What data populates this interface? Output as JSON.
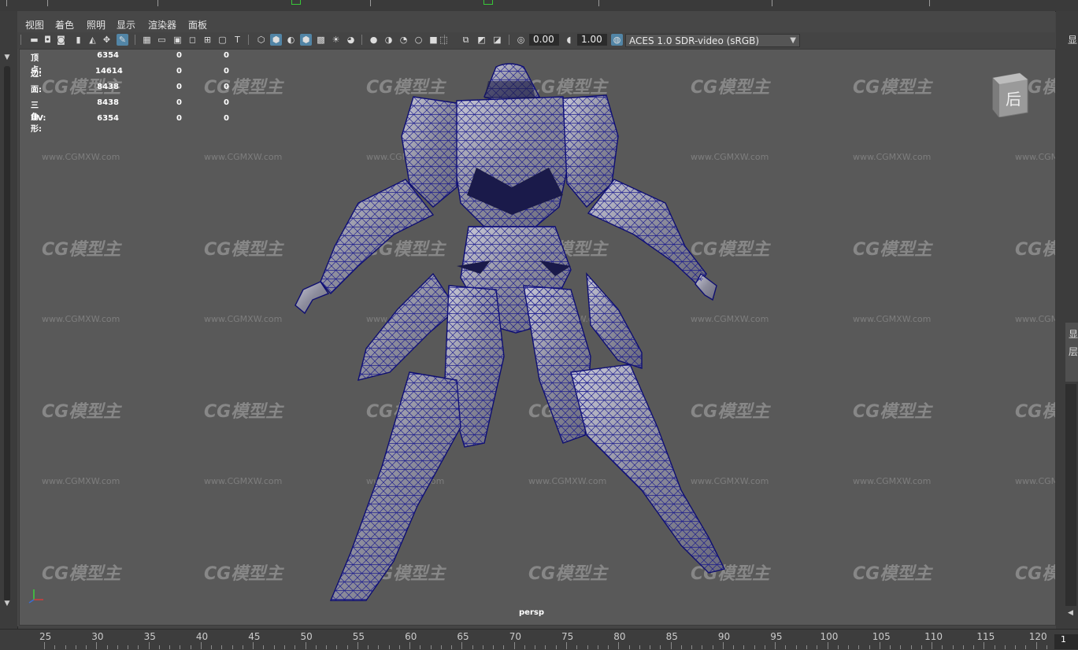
{
  "menu": [
    "视图",
    "着色",
    "照明",
    "显示",
    "渲染器",
    "面板"
  ],
  "toolbar": {
    "exposure": "0.00",
    "gamma": "1.00",
    "color_space": "ACES 1.0 SDR-video (sRGB)"
  },
  "stats": [
    {
      "label": "顶点:",
      "v1": "6354",
      "v2": "0",
      "v3": "0"
    },
    {
      "label": "边:",
      "v1": "14614",
      "v2": "0",
      "v3": "0"
    },
    {
      "label": "面:",
      "v1": "8438",
      "v2": "0",
      "v3": "0"
    },
    {
      "label": "三角形:",
      "v1": "8438",
      "v2": "0",
      "v3": "0"
    },
    {
      "label": "UV:",
      "v1": "6354",
      "v2": "0",
      "v3": "0"
    }
  ],
  "camera_label": "persp",
  "view_cube_label": "后",
  "right_dock": {
    "char1": "显",
    "char2": "层"
  },
  "watermark": {
    "logo": "CG模型主",
    "url": "www.CGMXW.com"
  },
  "timeline": {
    "numbers": [
      "25",
      "30",
      "35",
      "40",
      "45",
      "50",
      "55",
      "60",
      "65",
      "70",
      "75",
      "80",
      "85",
      "90",
      "95",
      "100",
      "105",
      "110",
      "115",
      "120"
    ],
    "current_frame": "1"
  },
  "colors": {
    "viewport_bg": "#595959",
    "wire": "#14148c",
    "active_btn": "#5285a6"
  }
}
